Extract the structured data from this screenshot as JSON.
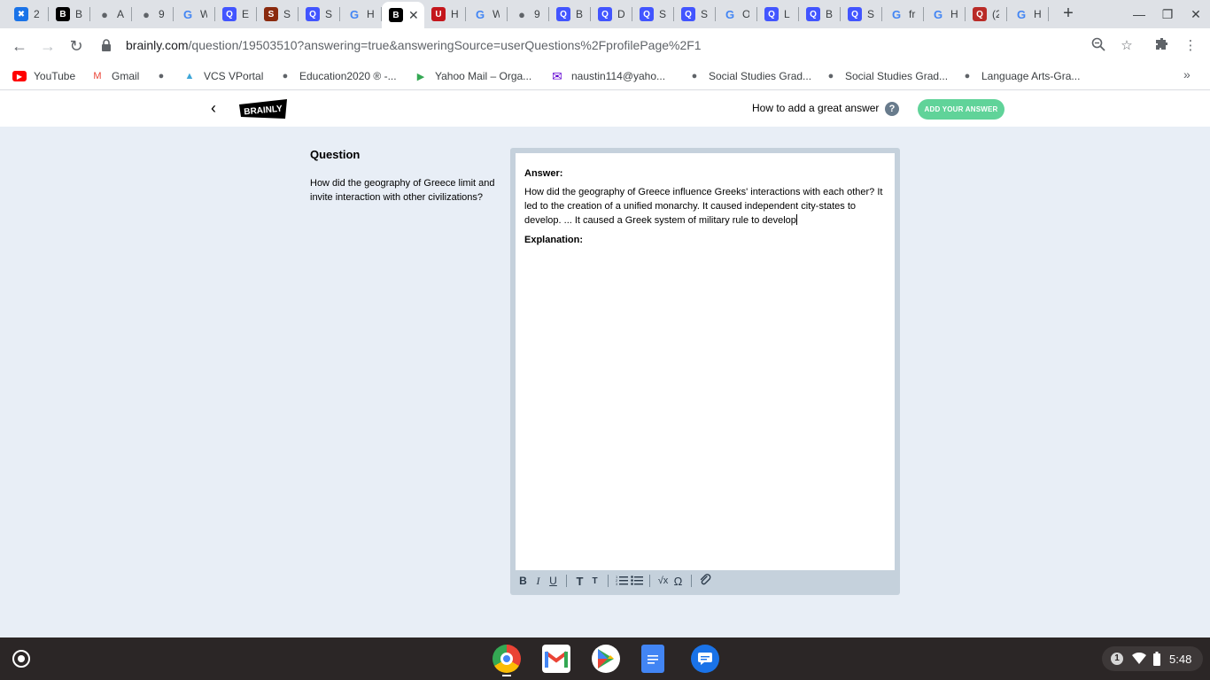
{
  "browser": {
    "tabs": [
      {
        "favicon": "x-icon",
        "label": "2",
        "color": "#1a73e8"
      },
      {
        "favicon": "brainly-icon",
        "label": "B",
        "color": "#000000"
      },
      {
        "favicon": "globe-icon",
        "label": "A",
        "color": "#5f6368"
      },
      {
        "favicon": "globe-icon",
        "label": "9",
        "color": "#5f6368"
      },
      {
        "favicon": "google-icon",
        "label": "W",
        "color": "#4285f4"
      },
      {
        "favicon": "quizlet-icon",
        "label": "E",
        "color": "#4255ff"
      },
      {
        "favicon": "sail-icon",
        "label": "S",
        "color": "#8a2a0e"
      },
      {
        "favicon": "quizlet-icon",
        "label": "S",
        "color": "#4255ff"
      },
      {
        "favicon": "google-icon",
        "label": "H",
        "color": "#4285f4"
      },
      {
        "favicon": "brainly-icon",
        "label": "",
        "color": "#000000",
        "active": true
      },
      {
        "favicon": "usnews-icon",
        "label": "H",
        "color": "#c4161c"
      },
      {
        "favicon": "google-icon",
        "label": "W",
        "color": "#4285f4"
      },
      {
        "favicon": "globe-icon",
        "label": "9",
        "color": "#5f6368"
      },
      {
        "favicon": "quizlet-icon",
        "label": "B",
        "color": "#4255ff"
      },
      {
        "favicon": "quizlet-icon",
        "label": "D",
        "color": "#4255ff"
      },
      {
        "favicon": "quizlet-icon",
        "label": "S",
        "color": "#4255ff"
      },
      {
        "favicon": "quizlet-icon",
        "label": "S",
        "color": "#4255ff"
      },
      {
        "favicon": "google-icon",
        "label": "O",
        "color": "#4285f4"
      },
      {
        "favicon": "quizlet-icon",
        "label": "L",
        "color": "#4255ff"
      },
      {
        "favicon": "quizlet-icon",
        "label": "B",
        "color": "#4255ff"
      },
      {
        "favicon": "quizlet-icon",
        "label": "S",
        "color": "#4255ff"
      },
      {
        "favicon": "google-icon",
        "label": "fr",
        "color": "#4285f4"
      },
      {
        "favicon": "google-icon",
        "label": "H",
        "color": "#4285f4"
      },
      {
        "favicon": "quora-icon",
        "label": "(2",
        "color": "#b92b27"
      },
      {
        "favicon": "google-icon",
        "label": "H",
        "color": "#4285f4"
      }
    ],
    "url_host": "brainly.com",
    "url_path": "/question/19503510?answering=true&answeringSource=userQuestions%2FprofilePage%2F1"
  },
  "bookmarks": [
    {
      "icon": "youtube-icon",
      "label": "YouTube",
      "color": "#ff0000"
    },
    {
      "icon": "gmail-icon",
      "label": "Gmail",
      "color": "#ea4335"
    },
    {
      "icon": "globe-icon",
      "label": "",
      "color": "#5f6368"
    },
    {
      "icon": "vcs-icon",
      "label": "VCS VPortal",
      "color": "#3ea6d8"
    },
    {
      "icon": "globe-icon",
      "label": "Education2020 ® -...",
      "color": "#5f6368"
    },
    {
      "icon": "yahoo-play-icon",
      "label": "Yahoo Mail – Orga...",
      "color": "#34a853"
    },
    {
      "icon": "mail-icon",
      "label": "naustin114@yaho...",
      "color": "#6001d2"
    },
    {
      "icon": "globe-icon",
      "label": "Social Studies Grad...",
      "color": "#5f6368"
    },
    {
      "icon": "globe-icon",
      "label": "Social Studies Grad...",
      "color": "#5f6368"
    },
    {
      "icon": "globe-icon",
      "label": "Language Arts-Gra...",
      "color": "#5f6368"
    }
  ],
  "header": {
    "logo_text": "BRAINLY",
    "how_to": "How to add a great answer",
    "add_button": "ADD YOUR ANSWER"
  },
  "question": {
    "title": "Question",
    "text": "How did the geography of Greece limit and invite interaction with other civilizations?"
  },
  "editor": {
    "answer_label": "Answer:",
    "answer_text": "How did the geography of Greece influence Greeks' interactions with each other? It led to the creation of a unified monarchy. It caused independent city-states to develop. ... It caused a Greek system of military rule to develop",
    "explanation_label": "Explanation:"
  },
  "shelf": {
    "apps": [
      "chrome-icon",
      "gmail-icon",
      "play-store-icon",
      "docs-icon",
      "messages-icon"
    ],
    "notification_count": "1",
    "time": "5:48"
  }
}
